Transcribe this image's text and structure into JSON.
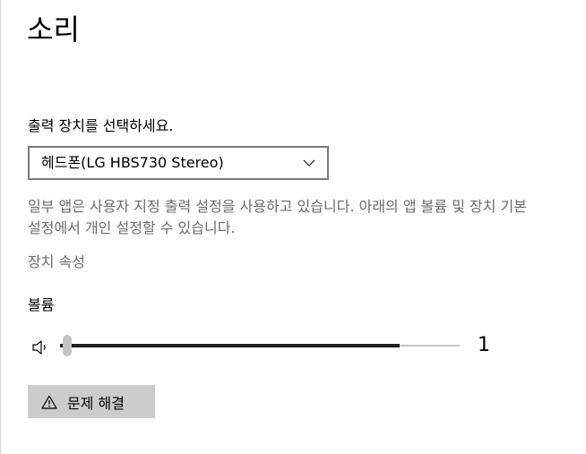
{
  "page": {
    "title": "소리"
  },
  "output": {
    "label": "출력 장치를 선택하세요.",
    "selected_device": "헤드폰(LG HBS730 Stereo)",
    "info_text": "일부 앱은 사용자 지정 출력 설정을 사용하고 있습니다. 아래의 앱 볼륨 및 장치 기본 설정에서 개인 설정할 수 있습니다.",
    "device_properties_link": "장치 속성"
  },
  "volume": {
    "label": "볼륨",
    "value_text": "1",
    "level_percent": 1,
    "playback_level_percent": 85
  },
  "troubleshoot": {
    "label": "문제 해결"
  },
  "icons": {
    "speaker": "speaker-icon",
    "dropdown": "chevron-down-icon",
    "warning": "warning-icon"
  },
  "colors": {
    "secondary_text": "#6b6b6b",
    "select_border": "#7a7a7a",
    "button_bg": "#cccccc",
    "slider_fill": "#1f1f1f",
    "slider_track": "#c7c7c7",
    "slider_thumb": "#c4c4c4"
  }
}
